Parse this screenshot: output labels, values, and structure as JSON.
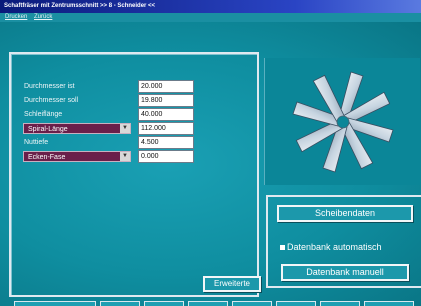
{
  "window": {
    "title": "Schaftfräser mit Zentrumsschnitt >> 8 - Schneider <<"
  },
  "menu": [
    {
      "label": "Drucken"
    },
    {
      "label": "Zurück"
    }
  ],
  "parameters": [
    {
      "label": "Durchmesser ist",
      "value": "20.000",
      "dropdown": false
    },
    {
      "label": "Durchmesser soll",
      "value": "19.800",
      "dropdown": false
    },
    {
      "label": "Schleiflänge",
      "value": "40.000",
      "dropdown": false
    },
    {
      "label": "Spiral-Länge",
      "value": "112.000",
      "dropdown": true
    },
    {
      "label": "Nuttiefe",
      "value": "4.500",
      "dropdown": false
    },
    {
      "label": "Ecken-Fase",
      "value": "0.000",
      "dropdown": true
    }
  ],
  "buttons": {
    "scheibendaten": "Scheibendaten",
    "datenbank_manuell": "Datenbank manuell",
    "erweiterte": "Erweiterte"
  },
  "checkbox": {
    "label": "Datenbank automatisch",
    "checked": true
  },
  "colors": {
    "background": "#0f8a9a",
    "dropdown": "#6a1f4a",
    "title_bar": "#0a1a7a"
  }
}
